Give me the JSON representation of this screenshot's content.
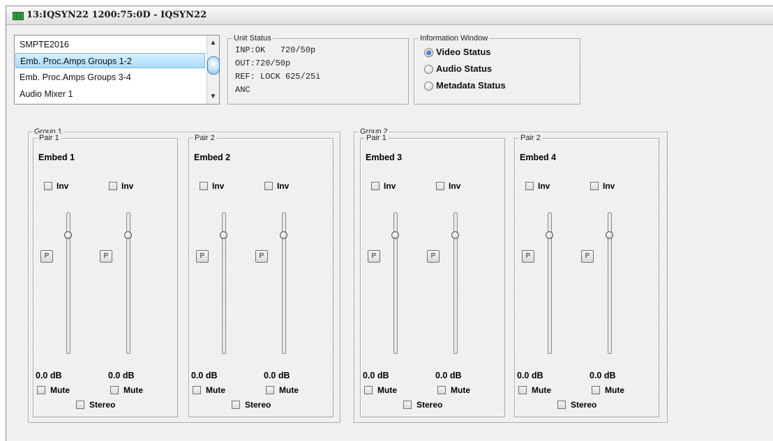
{
  "window": {
    "title": "13:IQSYN22  1200:75:0D  - IQSYN22"
  },
  "menu_list": {
    "items": [
      {
        "label": "SMPTE2016",
        "selected": false
      },
      {
        "label": "Emb. Proc.Amps Groups 1-2",
        "selected": true
      },
      {
        "label": "Emb. Proc.Amps Groups 3-4",
        "selected": false
      },
      {
        "label": "Audio Mixer 1",
        "selected": false
      }
    ],
    "scroll_up": "▲",
    "scroll_down": "▼"
  },
  "unit_status": {
    "title": "Unit Status",
    "lines": [
      "INP:OK   720/50p",
      "OUT:720/50p",
      "REF: LOCK 625/25i",
      "ANC"
    ]
  },
  "info_window": {
    "title": "Information Window",
    "options": [
      {
        "label": "Video Status",
        "selected": true
      },
      {
        "label": "Audio Status",
        "selected": false
      },
      {
        "label": "Metadata Status",
        "selected": false
      }
    ]
  },
  "groups": [
    {
      "label": "Group 1",
      "pairs": [
        {
          "label": "Pair 1",
          "embed": "Embed 1",
          "inv_label": "Inv",
          "p_label": "P",
          "left_db": "0.0 dB",
          "right_db": "0.0 dB",
          "mute_label": "Mute",
          "stereo_label": "Stereo"
        },
        {
          "label": "Pair 2",
          "embed": "Embed 2",
          "inv_label": "Inv",
          "p_label": "P",
          "left_db": "0.0 dB",
          "right_db": "0.0 dB",
          "mute_label": "Mute",
          "stereo_label": "Stereo"
        }
      ]
    },
    {
      "label": "Group 2",
      "pairs": [
        {
          "label": "Pair 1",
          "embed": "Embed 3",
          "inv_label": "Inv",
          "p_label": "P",
          "left_db": "0.0 dB",
          "right_db": "0.0 dB",
          "mute_label": "Mute",
          "stereo_label": "Stereo"
        },
        {
          "label": "Pair 2",
          "embed": "Embed 4",
          "inv_label": "Inv",
          "p_label": "P",
          "left_db": "0.0 dB",
          "right_db": "0.0 dB",
          "mute_label": "Mute",
          "stereo_label": "Stereo"
        }
      ]
    }
  ],
  "colors": {
    "selection": "#aadcff",
    "radio_on": "#124a99",
    "app_icon": "#2f9a3a"
  }
}
